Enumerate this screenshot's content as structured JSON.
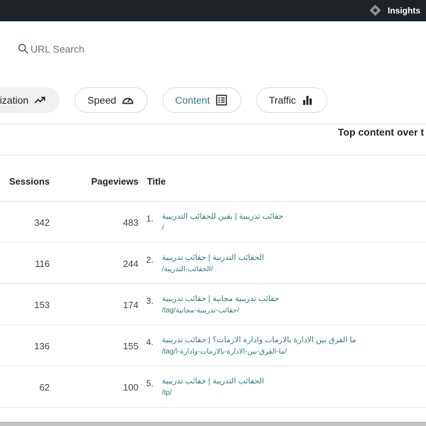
{
  "topbar": {
    "insights_label": "Insights"
  },
  "search": {
    "placeholder": "URL Search"
  },
  "tabs": [
    {
      "label": "Monetization",
      "visible_label": "etization",
      "icon": "trending-up-icon"
    },
    {
      "label": "Speed",
      "icon": "speedometer-icon"
    },
    {
      "label": "Content",
      "icon": "content-list-icon"
    },
    {
      "label": "Traffic",
      "icon": "bar-chart-icon"
    }
  ],
  "section": {
    "title": "Top content over t"
  },
  "table": {
    "headers": {
      "sessions": "Sessions",
      "pageviews": "Pageviews",
      "title": "Title"
    },
    "rows": [
      {
        "sessions": "342",
        "pageviews": "483",
        "rank": "1.",
        "title": "حقائب تدريبية | يقين للحقائب التدريبية",
        "url": "/"
      },
      {
        "sessions": "116",
        "pageviews": "244",
        "rank": "2.",
        "title": "الحقائب التدريبة | حقائب تدريبية",
        "url": "/الحقائب-التدريبة/"
      },
      {
        "sessions": "153",
        "pageviews": "174",
        "rank": "3.",
        "title": "حقائب تدريبية مجانية | حقائب تدريبية",
        "url": "/tag/حقائب-تدريبية-مجانية/"
      },
      {
        "sessions": "136",
        "pageviews": "155",
        "rank": "4.",
        "title": "ما الفرق بين الادارة بالازمات وادارة الازمات؟ | حقائب تدريبية",
        "url": "/tag/ما-الفرق-بين-الادارة-بالازمات-وادارة-ا/"
      },
      {
        "sessions": "62",
        "pageviews": "100",
        "rank": "5.",
        "title": "الحقائب التدريبة | حقائب تدريبية",
        "url": "/tp/"
      }
    ]
  }
}
